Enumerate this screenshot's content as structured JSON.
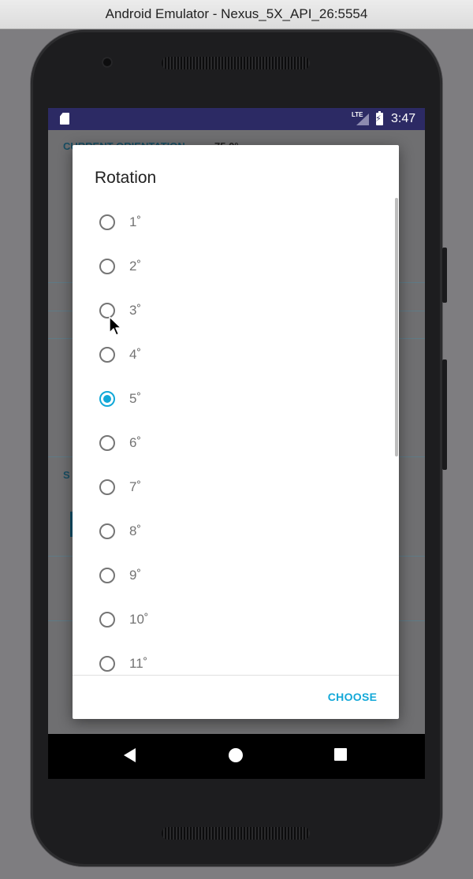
{
  "window": {
    "title": "Android Emulator - Nexus_5X_API_26:5554"
  },
  "status_bar": {
    "network": "LTE",
    "time": "3:47",
    "status_color": "#2c2a64"
  },
  "background_screen": {
    "heading_fragment": "CURRENT ORIENTATION",
    "heading_value_fragment": "75.0°",
    "section_fragment": "S"
  },
  "dialog": {
    "title": "Rotation",
    "options": [
      "1˚",
      "2˚",
      "3˚",
      "4˚",
      "5˚",
      "6˚",
      "7˚",
      "8˚",
      "9˚",
      "10˚",
      "11˚"
    ],
    "selected_option": "5˚",
    "action_label": "CHOOSE",
    "accent_color": "#12a8d8"
  },
  "nav_bar": {
    "icons": [
      "back-icon",
      "home-icon",
      "recent-apps-icon"
    ]
  }
}
